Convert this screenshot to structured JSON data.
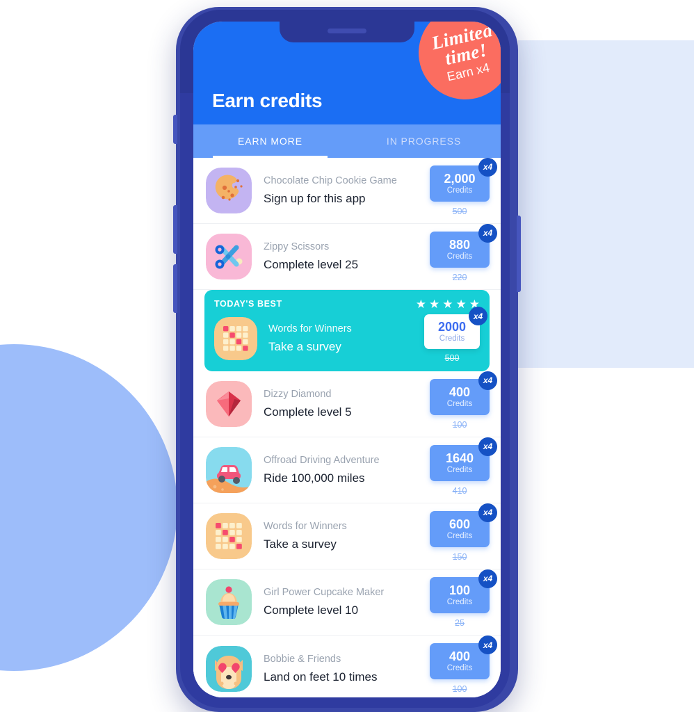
{
  "background": {
    "page_bg": "#ffffff",
    "rect_color": "#e2ebfb",
    "circle_color": "#9dbdfa"
  },
  "device": {
    "frame_color": "#3a47a8",
    "frame_inner_color": "#2f3ba0",
    "screen_bg": "#ffffff"
  },
  "header": {
    "title": "Earn credits",
    "bg_color": "#1b6ef3",
    "promo": {
      "line1": "Limited time!",
      "line2": "Earn x4",
      "bg_color": "#fb6d60"
    }
  },
  "tabs": {
    "bg_color": "#649cf9",
    "items": [
      {
        "label": "EARN MORE",
        "active": true
      },
      {
        "label": "IN PROGRESS",
        "active": false
      }
    ]
  },
  "reward_defaults": {
    "unit": "Credits",
    "multiplier": "x4",
    "box_color": "#649cf9",
    "multiplier_color": "#1551c4"
  },
  "featured": {
    "label": "TODAY'S BEST",
    "stars": [
      "★",
      "★",
      "★",
      "★",
      "★"
    ],
    "star_count": 5,
    "bg_color": "#17cfd6",
    "icon": "words-for-winners-icon",
    "app_name": "Words for Winners",
    "task": "Take a survey",
    "amount": "2000",
    "unit": "Credits",
    "multiplier": "x4",
    "old_amount": "500"
  },
  "rows": [
    {
      "icon": "cookie-icon",
      "app_name": "Chocolate Chip Cookie Game",
      "task": "Sign up for this app",
      "amount": "2,000",
      "unit": "Credits",
      "multiplier": "x4",
      "old_amount": "500"
    },
    {
      "icon": "scissors-icon",
      "app_name": "Zippy Scissors",
      "task": "Complete level 25",
      "amount": "880",
      "unit": "Credits",
      "multiplier": "x4",
      "old_amount": "220"
    },
    {
      "icon": "diamond-icon",
      "app_name": "Dizzy Diamond",
      "task": "Complete level 5",
      "amount": "400",
      "unit": "Credits",
      "multiplier": "x4",
      "old_amount": "100"
    },
    {
      "icon": "offroad-car-icon",
      "app_name": "Offroad Driving Adventure",
      "task": "Ride 100,000 miles",
      "amount": "1640",
      "unit": "Credits",
      "multiplier": "x4",
      "old_amount": "410"
    },
    {
      "icon": "words-for-winners-icon",
      "app_name": "Words for Winners",
      "task": "Take a survey",
      "amount": "600",
      "unit": "Credits",
      "multiplier": "x4",
      "old_amount": "150"
    },
    {
      "icon": "cupcake-icon",
      "app_name": "Girl Power Cupcake Maker",
      "task": "Complete level 10",
      "amount": "100",
      "unit": "Credits",
      "multiplier": "x4",
      "old_amount": "25"
    },
    {
      "icon": "dog-icon",
      "app_name": "Bobbie & Friends",
      "task": "Land on feet 10 times",
      "amount": "400",
      "unit": "Credits",
      "multiplier": "x4",
      "old_amount": "100"
    }
  ]
}
